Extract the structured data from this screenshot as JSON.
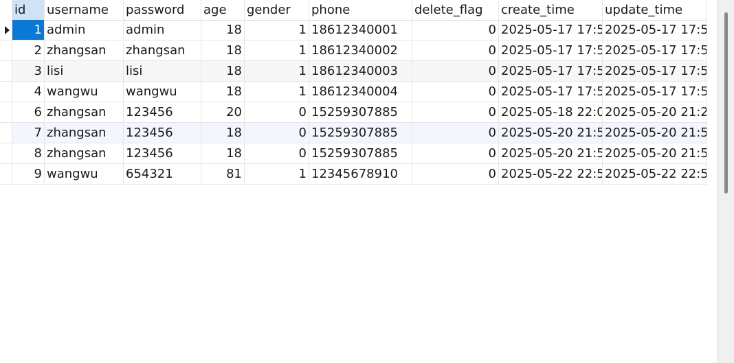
{
  "columns": [
    "id",
    "username",
    "password",
    "age",
    "gender",
    "phone",
    "delete_flag",
    "create_time",
    "update_time"
  ],
  "rows": [
    {
      "id": "1",
      "username": "admin",
      "password": "admin",
      "age": "18",
      "gender": "1",
      "phone": "18612340001",
      "delete_flag": "0",
      "create_time": "2025-05-17 17:5",
      "update_time": "2025-05-17 17:5"
    },
    {
      "id": "2",
      "username": "zhangsan",
      "password": "zhangsan",
      "age": "18",
      "gender": "1",
      "phone": "18612340002",
      "delete_flag": "0",
      "create_time": "2025-05-17 17:5",
      "update_time": "2025-05-17 17:5"
    },
    {
      "id": "3",
      "username": "lisi",
      "password": "lisi",
      "age": "18",
      "gender": "1",
      "phone": "18612340003",
      "delete_flag": "0",
      "create_time": "2025-05-17 17:5",
      "update_time": "2025-05-17 17:5"
    },
    {
      "id": "4",
      "username": "wangwu",
      "password": "wangwu",
      "age": "18",
      "gender": "1",
      "phone": "18612340004",
      "delete_flag": "0",
      "create_time": "2025-05-17 17:5",
      "update_time": "2025-05-17 17:5"
    },
    {
      "id": "6",
      "username": "zhangsan",
      "password": "123456",
      "age": "20",
      "gender": "0",
      "phone": "15259307885",
      "delete_flag": "0",
      "create_time": "2025-05-18 22:0",
      "update_time": "2025-05-20 21:2"
    },
    {
      "id": "7",
      "username": "zhangsan",
      "password": "123456",
      "age": "18",
      "gender": "0",
      "phone": "15259307885",
      "delete_flag": "0",
      "create_time": "2025-05-20 21:5",
      "update_time": "2025-05-20 21:5"
    },
    {
      "id": "8",
      "username": "zhangsan",
      "password": "123456",
      "age": "18",
      "gender": "0",
      "phone": "15259307885",
      "delete_flag": "0",
      "create_time": "2025-05-20 21:5",
      "update_time": "2025-05-20 21:5"
    },
    {
      "id": "9",
      "username": "wangwu",
      "password": "654321",
      "age": "81",
      "gender": "1",
      "phone": "12345678910",
      "delete_flag": "0",
      "create_time": "2025-05-22 22:5",
      "update_time": "2025-05-22 22:5"
    }
  ],
  "colors": {
    "selection": "#0a78d4",
    "header_selected": "#cfe2f6",
    "row_alt": "#f7f7f7",
    "row_hover": "#f2f7fd",
    "gridline": "#e6e6e6"
  },
  "icons": {
    "current_row_marker": "triangle-right"
  }
}
